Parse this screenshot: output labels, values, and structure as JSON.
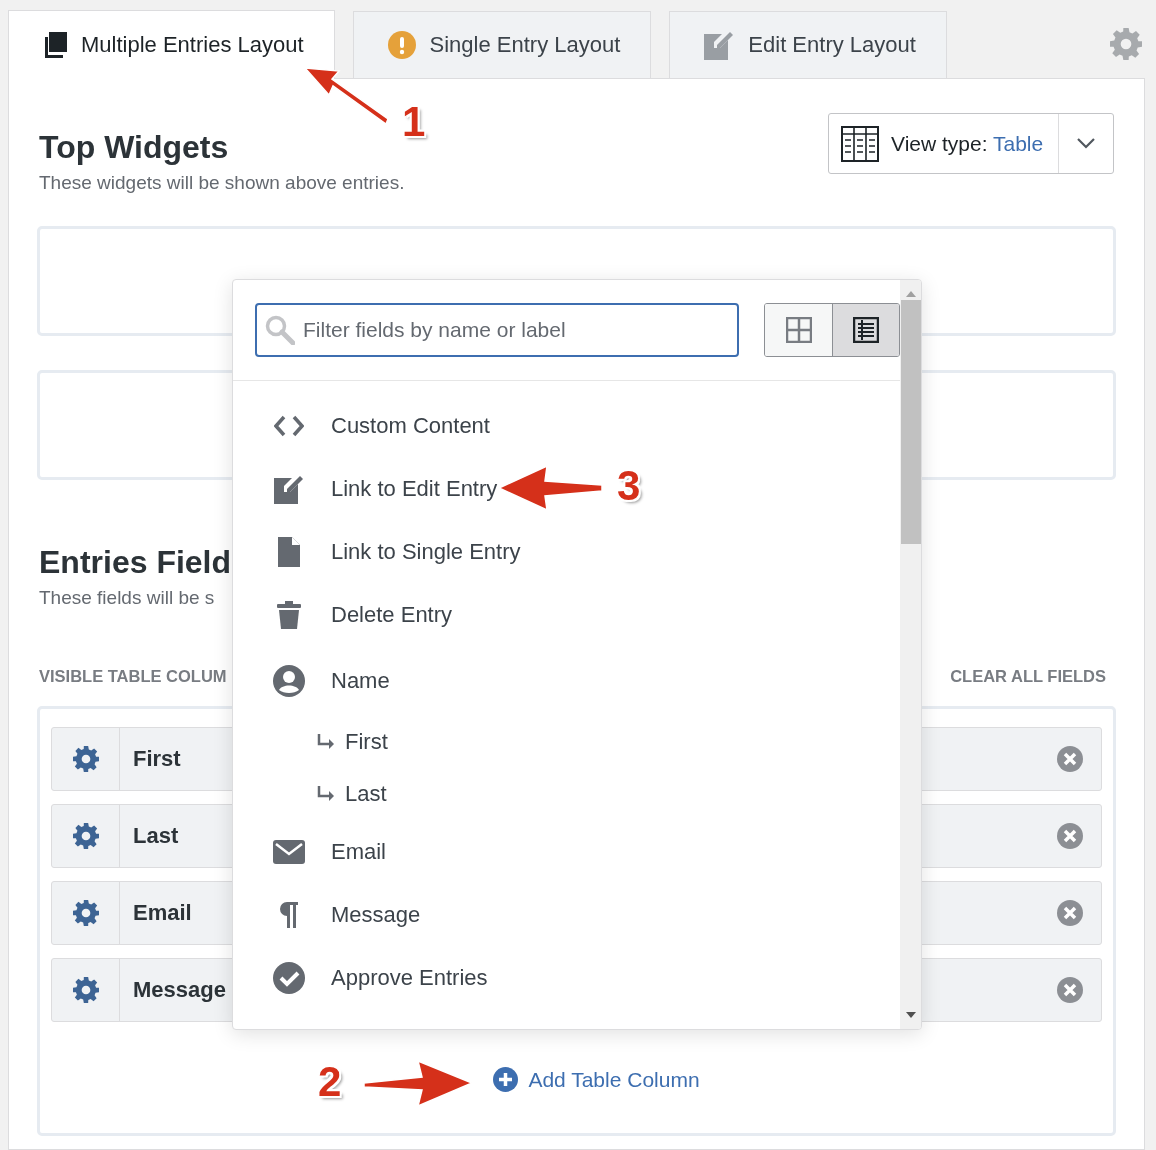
{
  "tabs": [
    {
      "label": "Multiple Entries Layout",
      "kind": "multiple",
      "selected": true
    },
    {
      "label": "Single Entry Layout",
      "kind": "single",
      "selected": false
    },
    {
      "label": "Edit Entry Layout",
      "kind": "edit",
      "selected": false
    }
  ],
  "top_widgets": {
    "title": "Top Widgets",
    "subtitle": "These widgets will be shown above entries."
  },
  "view_type": {
    "label": "View type:",
    "value": "Table"
  },
  "entries_fields": {
    "title": "Entries Field",
    "subtitle": "These fields will be s",
    "columns_label": "VISIBLE TABLE COLUM",
    "clear_label": "CLEAR ALL FIELDS"
  },
  "columns": [
    {
      "label": "First"
    },
    {
      "label": "Last"
    },
    {
      "label": "Email"
    },
    {
      "label": "Message"
    }
  ],
  "add_column": "Add Table Column",
  "field_picker": {
    "search": {
      "placeholder": "Filter fields by name or label"
    },
    "view_toggle": [
      {
        "kind": "grid",
        "selected": false
      },
      {
        "kind": "list",
        "selected": true
      }
    ],
    "fields": [
      {
        "label": "Custom Content",
        "kind": "code"
      },
      {
        "label": "Link to Edit Entry",
        "kind": "edit"
      },
      {
        "label": "Link to Single Entry",
        "kind": "file"
      },
      {
        "label": "Delete Entry",
        "kind": "trash"
      },
      {
        "label": "Name",
        "kind": "user",
        "children": [
          {
            "label": "First"
          },
          {
            "label": "Last"
          }
        ]
      },
      {
        "label": "Email",
        "kind": "mail"
      },
      {
        "label": "Message",
        "kind": "paragraph"
      },
      {
        "label": "Approve Entries",
        "kind": "check"
      }
    ]
  },
  "annotations": [
    {
      "label": "1"
    },
    {
      "label": "3"
    },
    {
      "label": "2"
    }
  ]
}
